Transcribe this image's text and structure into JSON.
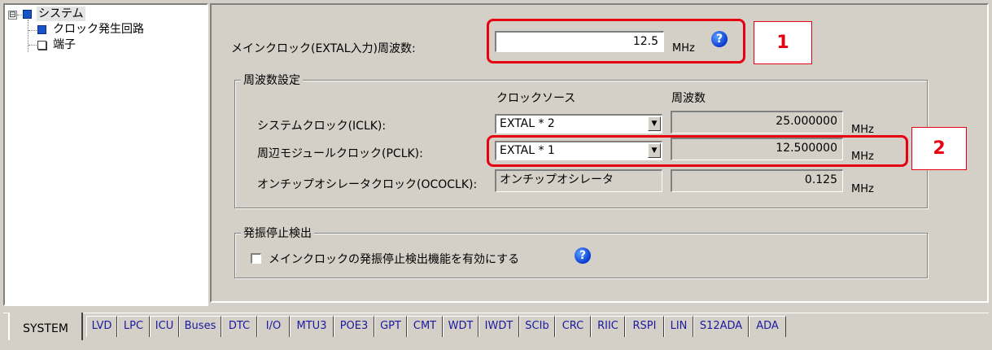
{
  "tree": {
    "root": {
      "expander": "⊟",
      "label": "システム"
    },
    "children": [
      {
        "label": "クロック発生回路",
        "icon": "blue-square-icon"
      },
      {
        "label": "端子",
        "icon": "white-square-icon"
      }
    ]
  },
  "main_clock": {
    "label": "メインクロック(EXTAL入力)周波数:",
    "value": "12.5",
    "unit": "MHz",
    "help": "?"
  },
  "freq_settings": {
    "title": "周波数設定",
    "col_source": "クロックソース",
    "col_freq": "周波数",
    "rows": [
      {
        "label": "システムクロック(ICLK):",
        "source": "EXTAL * 2",
        "freq": "25.000000",
        "unit": "MHz"
      },
      {
        "label": "周辺モジュールクロック(PCLK):",
        "source": "EXTAL * 1",
        "freq": "12.500000",
        "unit": "MHz"
      },
      {
        "label": "オンチップオシレータクロック(OCOCLK):",
        "source": "オンチップオシレータ",
        "freq": "0.125",
        "unit": "MHz"
      }
    ]
  },
  "osc_stop": {
    "title": "発振停止検出",
    "checkbox_label": "メインクロックの発振停止検出機能を有効にする",
    "checked": false,
    "help": "?"
  },
  "callouts": [
    "1",
    "2"
  ],
  "tabs": [
    "SYSTEM",
    "LVD",
    "LPC",
    "ICU",
    "Buses",
    "DTC",
    "I/O",
    "MTU3",
    "POE3",
    "GPT",
    "CMT",
    "WDT",
    "IWDT",
    "SCIb",
    "CRC",
    "RIIC",
    "RSPI",
    "LIN",
    "S12ADA",
    "ADA"
  ],
  "active_tab": "SYSTEM",
  "colors": {
    "highlight": "#e60012",
    "help_icon": "#0a3ad0",
    "tree_icon": "#1654c8"
  }
}
